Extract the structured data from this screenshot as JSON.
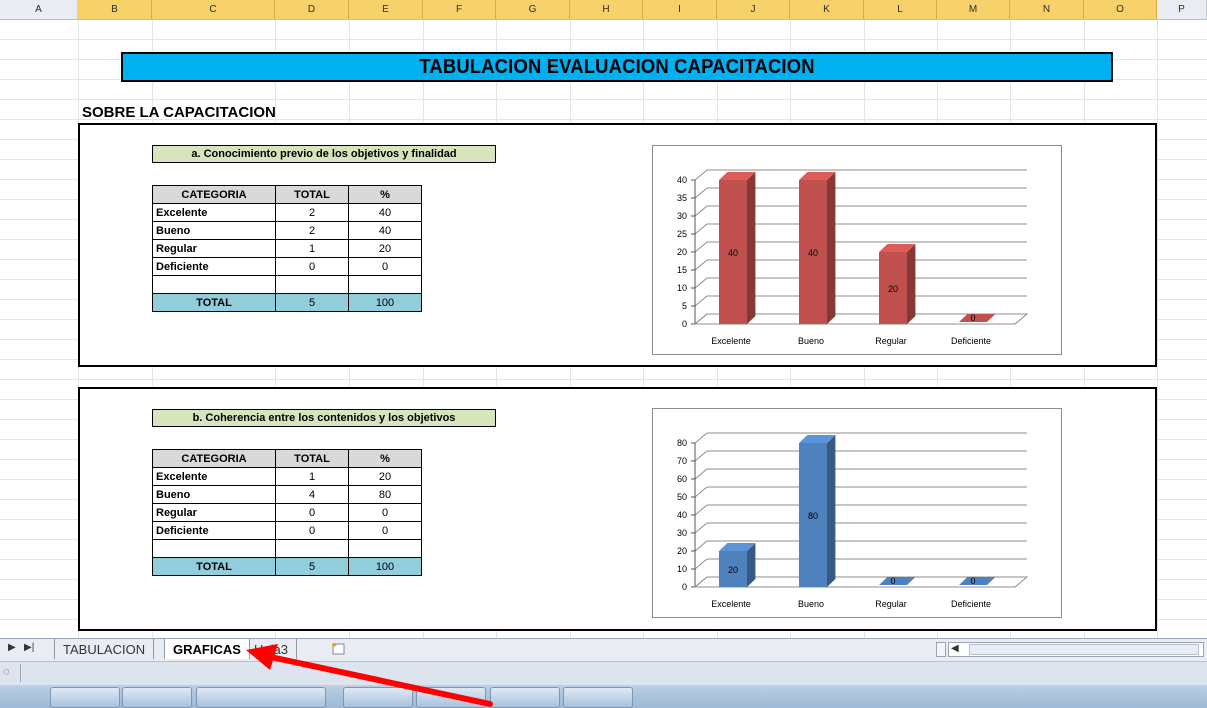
{
  "columns": [
    "A",
    "B",
    "C",
    "D",
    "E",
    "F",
    "G",
    "H",
    "I",
    "J",
    "K",
    "L",
    "M",
    "N",
    "O",
    "P"
  ],
  "title": "TABULACION EVALUACION CAPACITACION",
  "section_title": "SOBRE LA CAPACITACION",
  "table_headers": {
    "categoria": "CATEGORIA",
    "total": "TOTAL",
    "pct": "%"
  },
  "block_a": {
    "subtitle": "a. Conocimiento previo de los objetivos y finalidad",
    "rows": [
      {
        "cat": "Excelente",
        "total": "2",
        "pct": "40"
      },
      {
        "cat": "Bueno",
        "total": "2",
        "pct": "40"
      },
      {
        "cat": "Regular",
        "total": "1",
        "pct": "20"
      },
      {
        "cat": "Deficiente",
        "total": "0",
        "pct": "0"
      }
    ],
    "total_row": {
      "label": "TOTAL",
      "total": "5",
      "pct": "100"
    }
  },
  "block_b": {
    "subtitle": "b. Coherencia entre los contenidos y los objetivos",
    "rows": [
      {
        "cat": "Excelente",
        "total": "1",
        "pct": "20"
      },
      {
        "cat": "Bueno",
        "total": "4",
        "pct": "80"
      },
      {
        "cat": "Regular",
        "total": "0",
        "pct": "0"
      },
      {
        "cat": "Deficiente",
        "total": "0",
        "pct": "0"
      }
    ],
    "total_row": {
      "label": "TOTAL",
      "total": "5",
      "pct": "100"
    }
  },
  "chart_data": [
    {
      "type": "bar",
      "categories": [
        "Excelente",
        "Bueno",
        "Regular",
        "Deficiente"
      ],
      "values": [
        40,
        40,
        20,
        0
      ],
      "ylim": [
        0,
        40
      ],
      "yticks": [
        0,
        5,
        10,
        15,
        20,
        25,
        30,
        35,
        40
      ],
      "color": "#c0504d",
      "data_labels": true,
      "grid": true
    },
    {
      "type": "bar",
      "categories": [
        "Excelente",
        "Bueno",
        "Regular",
        "Deficiente"
      ],
      "values": [
        20,
        80,
        0,
        0
      ],
      "ylim": [
        0,
        80
      ],
      "yticks": [
        0,
        10,
        20,
        30,
        40,
        50,
        60,
        70,
        80
      ],
      "color": "#4f81bd",
      "data_labels": true,
      "grid": true
    }
  ],
  "tabs": [
    {
      "label": "TABULACION",
      "active": false
    },
    {
      "label": "GRAFICAS",
      "active": true
    },
    {
      "label": "Hoja3",
      "active": false
    }
  ],
  "annotation_color": "#ff0000"
}
